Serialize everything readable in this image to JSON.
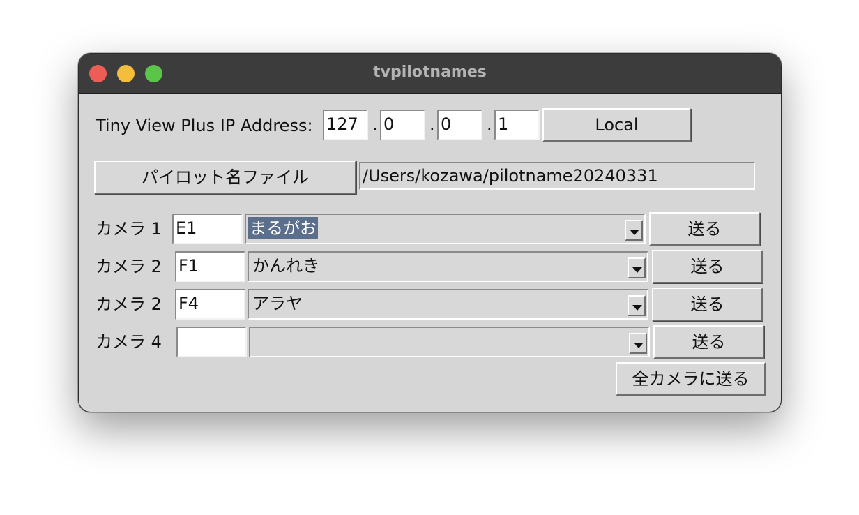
{
  "window": {
    "title": "tvpilotnames"
  },
  "ip": {
    "label": "Tiny View Plus IP Address:",
    "octets": [
      "127",
      "0",
      "0",
      "1"
    ],
    "separator": ".",
    "local_button": "Local"
  },
  "pilot_file": {
    "button_label": "パイロット名ファイル",
    "path": "/Users/kozawa/pilotname20240331"
  },
  "cameras": [
    {
      "label": "カメラ 1",
      "code": "E1",
      "pilot": "まるがお",
      "send_label": "送る",
      "selected": true
    },
    {
      "label": "カメラ 2",
      "code": "F1",
      "pilot": "かんれき",
      "send_label": "送る",
      "selected": false
    },
    {
      "label": "カメラ 2",
      "code": "F4",
      "pilot": "アラヤ",
      "send_label": "送る",
      "selected": false
    },
    {
      "label": "カメラ 4",
      "code": "",
      "pilot": "",
      "send_label": "送る",
      "selected": false
    }
  ],
  "send_all_label": "全カメラに送る",
  "colors": {
    "window_bg": "#d6d6d6",
    "titlebar_bg": "#3c3c3c",
    "close": "#ee5d55",
    "minimize": "#f5bd3c",
    "zoom": "#5ac548",
    "selection": "#5b6f8c"
  }
}
